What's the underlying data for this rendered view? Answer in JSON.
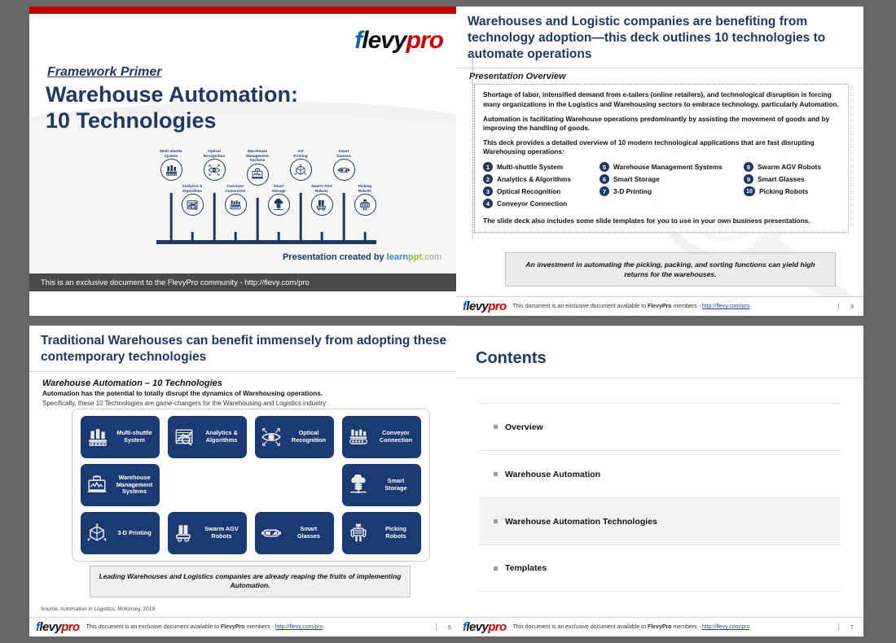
{
  "brand": {
    "logo_f": "f",
    "logo_levy": "levy",
    "logo_pro": "pro",
    "accent_navy": "#1f3864",
    "accent_red": "#c00000",
    "accent_blue": "#0a62c0",
    "tile_navy": "#1b3a73"
  },
  "slide1": {
    "eyebrow": "Framework Primer",
    "title_line1": "Warehouse Automation:",
    "title_line2": "10 Technologies",
    "created_by_prefix": "Presentation created by",
    "created_by_brand_learn": "learn",
    "created_by_brand_p": "pp",
    "created_by_brand_t": "t",
    "created_by_brand_com": ".com",
    "footer": "This is an exclusive document to the FlevyPro community - http://flevy.com/pro",
    "timeline": {
      "top_nodes": [
        {
          "label": "Multi-shuttle\nSystem",
          "icon": "multi-shuttle-icon"
        },
        {
          "label": "Optical\nRecognition",
          "icon": "optical-recognition-icon"
        },
        {
          "label": "Warehouse\nManagement\nSystems",
          "icon": "wms-icon"
        },
        {
          "label": "3-D\nPrinting",
          "icon": "3d-printing-icon"
        },
        {
          "label": "Smart\nGlasses",
          "icon": "smart-glasses-icon"
        }
      ],
      "bottom_nodes": [
        {
          "label": "Analytics &\nAlgorithms",
          "icon": "analytics-icon"
        },
        {
          "label": "Conveyor\nConnection",
          "icon": "conveyor-icon"
        },
        {
          "label": "Smart\nStorage",
          "icon": "smart-storage-icon"
        },
        {
          "label": "Swarm AGV\nRobots",
          "icon": "swarm-agv-icon"
        },
        {
          "label": "Picking\nRobots",
          "icon": "picking-robots-icon"
        }
      ]
    }
  },
  "slide2": {
    "title": "Warehouses and Logistic companies are benefiting from technology adoption—this deck outlines 10 technologies to automate operations",
    "subtitle": "Presentation Overview",
    "para1": "Shortage of labor, intensified demand from e-tailers (online retailers), and technological disruption is forcing many organizations in the Logistics and Warehousing sectors to embrace technology, particularly Automation.",
    "para2": "Automation is facilitating Warehouse operations predominantly by assisting the movement of goods and by improving the handling of goods.",
    "para3": "This deck provides a detailed overview of 10 modern technological applications that are fast disrupting Warehousing operations:",
    "para4": "The slide deck also includes some slide templates for you to use in your own business presentations.",
    "col1": [
      {
        "num": "1",
        "label": "Multi-shuttle System"
      },
      {
        "num": "2",
        "label": "Analytics & Algorithms"
      },
      {
        "num": "3",
        "label": "Optical Recognition"
      },
      {
        "num": "4",
        "label": "Conveyor Connection"
      }
    ],
    "col2": [
      {
        "num": "5",
        "label": "Warehouse Management Systems"
      },
      {
        "num": "6",
        "label": "Smart Storage"
      },
      {
        "num": "7",
        "label": "3-D Printing"
      }
    ],
    "col3": [
      {
        "num": "8",
        "label": "Swarm AGV Robots"
      },
      {
        "num": "9",
        "label": "Smart Glasses"
      },
      {
        "num": "10",
        "label": "Picking Robots"
      }
    ],
    "callout": "An investment in automating the picking, packing, and sorting functions can yield high returns for the warehouses.",
    "footer_text_a": "This document is an exclusive document available to ",
    "footer_brand": "FlevyPro",
    "footer_text_b": " members - ",
    "footer_link": "http://flevy.com/pro",
    "page": "3"
  },
  "slide3": {
    "title": "Traditional Warehouses can benefit immensely from adopting these contemporary technologies",
    "subtitle": "Warehouse Automation – 10 Technologies",
    "lead1": "Automation has the potential to totally disrupt the dynamics of Warehousing operations.",
    "lead2": "Specifically, these 10 Technologies are game-changers for the Warehousing and Logistics industry:",
    "tiles": [
      {
        "label": "Multi-shuttle\nSystem",
        "icon": "multi-shuttle-icon"
      },
      {
        "label": "Analytics &\nAlgorithms",
        "icon": "analytics-icon"
      },
      {
        "label": "Optical\nRecognition",
        "icon": "optical-recognition-icon"
      },
      {
        "label": "Conveyor\nConnection",
        "icon": "conveyor-icon"
      },
      {
        "label": "Warehouse\nManagement\nSystems",
        "icon": "wms-icon"
      },
      {
        "label": "",
        "icon": ""
      },
      {
        "label": "",
        "icon": ""
      },
      {
        "label": "Smart\nStorage",
        "icon": "smart-storage-icon"
      },
      {
        "label": "3-D Printing",
        "icon": "3d-printing-icon"
      },
      {
        "label": "Swarm AGV\nRobots",
        "icon": "swarm-agv-icon"
      },
      {
        "label": "Smart\nGlasses",
        "icon": "smart-glasses-icon"
      },
      {
        "label": "Picking\nRobots",
        "icon": "picking-robots-icon"
      }
    ],
    "callout": "Leading Warehouses and Logistics companies are already reaping the fruits of implementing Automation.",
    "source": "Source: Automation in Logistics, McKinsey, 2019",
    "footer_text_a": "This document is an exclusive document available to ",
    "footer_brand": "FlevyPro",
    "footer_text_b": " members - ",
    "footer_link": "http://flevy.com/pro",
    "page": "6"
  },
  "slide4": {
    "title": "Contents",
    "items": [
      {
        "label": "Overview",
        "active": false
      },
      {
        "label": "Warehouse Automation",
        "active": false
      },
      {
        "label": "Warehouse Automation Technologies",
        "active": true
      },
      {
        "label": "Templates",
        "active": false
      }
    ],
    "footer_text_a": "This document is an exclusive document available to ",
    "footer_brand": "FlevyPro",
    "footer_text_b": " members - ",
    "footer_link": "http://flevy.com/pro",
    "page": "7"
  }
}
